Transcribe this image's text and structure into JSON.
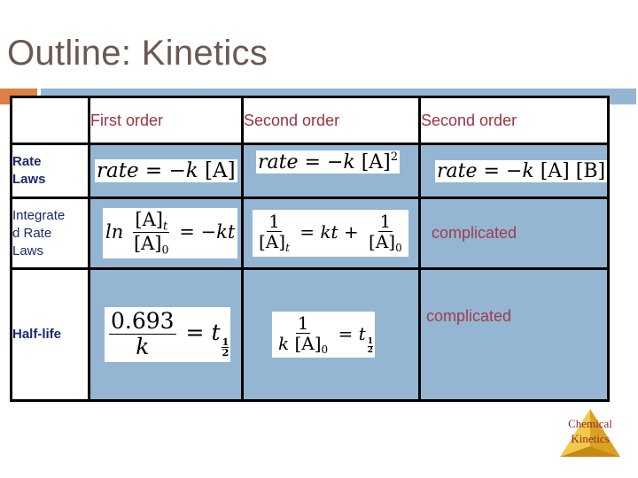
{
  "slide": {
    "title": "Outline: Kinetics"
  },
  "table": {
    "headers": [
      "",
      "First order",
      "Second order",
      "Second order"
    ],
    "rows": [
      {
        "label": "Rate Laws",
        "first_order": "rate = −k [A]",
        "second_order_a": "rate = −k [A]^2",
        "second_order_ab": "rate = −k [A] [B]"
      },
      {
        "label": "Integrated Rate Laws",
        "first_order": "ln [A]_t / [A]_0 = −kt",
        "second_order_a": "1/[A]_t = kt + 1/[A]_0",
        "second_order_ab": "complicated"
      },
      {
        "label": "Half-life",
        "first_order": "0.693 / k = t_1/2",
        "second_order_a": "1 / (k [A]_0) = t_1/2",
        "second_order_ab": "complicated"
      }
    ],
    "labels": {
      "rate_laws_line1": "Rate",
      "rate_laws_line2": "Laws",
      "integrated_line1": "Integrate",
      "integrated_line2": "d Rate",
      "integrated_line3": "Laws",
      "half_life": "Half-life"
    },
    "math": {
      "rate": "rate",
      "eq": "=",
      "minus_k": "−k",
      "A": "[A]",
      "B": "[B]",
      "two": "2",
      "ln": "ln",
      "t": "t",
      "zero": "0",
      "minus_kt": "−kt",
      "one": "1",
      "kt_plus": "kt +",
      "k": "k",
      "k_A": "k [A]",
      "c0693": "0.693",
      "half_num": "1",
      "half_den": "2"
    }
  },
  "logo": {
    "line1": "Chemical",
    "line2": "Kinetics",
    "icon": "pyramid-icon"
  },
  "colors": {
    "title": "#6b5850",
    "accent_orange": "#dd8047",
    "accent_blue": "#94b6d2",
    "header_text": "#9a3340",
    "row_label_text": "#1b2a6b",
    "complicated_text": "#a33b4a",
    "logo_gold": "#e8b83a"
  }
}
